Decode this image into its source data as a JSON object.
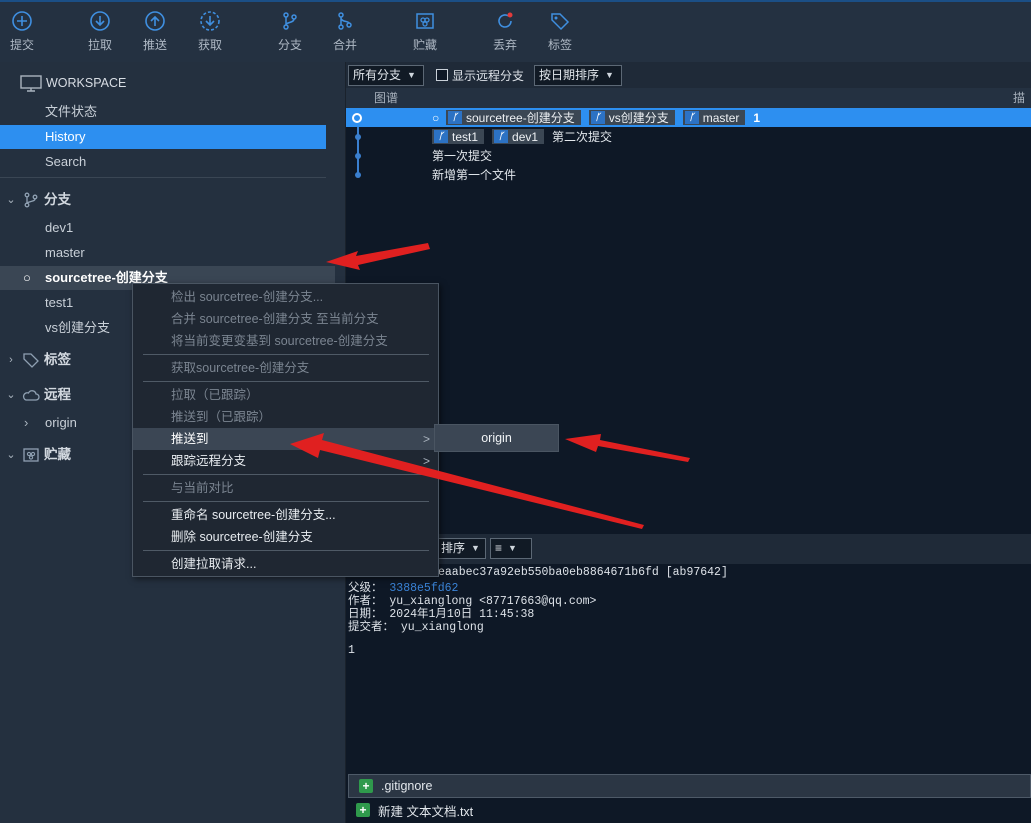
{
  "toolbar": {
    "commit": "提交",
    "pull": "拉取",
    "push": "推送",
    "fetch": "获取",
    "branch": "分支",
    "merge": "合并",
    "stash": "贮藏",
    "discard": "丢弃",
    "tag": "标签"
  },
  "sidebar": {
    "workspace": "WORKSPACE",
    "workspace_items": [
      "文件状态",
      "History",
      "Search"
    ],
    "branches_header": "分支",
    "branches": [
      "dev1",
      "master",
      "sourcetree-创建分支",
      "test1",
      "vs创建分支"
    ],
    "tags_header": "标签",
    "remotes_header": "远程",
    "remote_origin": "origin",
    "stash_header": "贮藏"
  },
  "filterbar": {
    "branch_select": "所有分支",
    "show_remote": "显示远程分支",
    "sort_select": "按日期排序"
  },
  "columns": {
    "graph": "图谱",
    "desc": "描"
  },
  "commits": [
    {
      "tags": [
        "sourcetree-创建分支",
        "vs创建分支",
        "master"
      ],
      "message": "1"
    },
    {
      "tags": [
        "test1",
        "dev1"
      ],
      "message": "第二次提交"
    },
    {
      "tags": [],
      "message": "第一次提交"
    },
    {
      "tags": [],
      "message": "新增第一个文件"
    }
  ],
  "lower_bar": {
    "sort_select": "排序",
    "view_select": "≡"
  },
  "details": {
    "commit_hash_tail": "eaabec37a92eb550ba0eb8864671b6fd [ab97642]",
    "parent_label": "父级：",
    "parent_hash": "3388e5fd62",
    "author_label": "作者：",
    "author": "yu_xianglong <87717663@qq.com>",
    "date_label": "日期：",
    "date": "2024年1月10日 11:45:38",
    "committer_label": "提交者：",
    "committer": "yu_xianglong",
    "message": "1"
  },
  "files": [
    ".gitignore",
    "新建 文本文档.txt"
  ],
  "context_menu": {
    "checkout": "检出 sourcetree-创建分支...",
    "merge_into": "合并 sourcetree-创建分支 至当前分支",
    "rebase": "将当前变更变基到 sourcetree-创建分支",
    "fetch": "获取sourcetree-创建分支",
    "pull_tracked": "拉取（已跟踪）",
    "push_tracked": "推送到（已跟踪）",
    "push_to": "推送到",
    "track_remote": "跟踪远程分支",
    "diff_current": "与当前对比",
    "rename": "重命名 sourcetree-创建分支...",
    "delete": "删除 sourcetree-创建分支",
    "create_pr": "创建拉取请求..."
  },
  "submenu": {
    "origin": "origin"
  },
  "colors": {
    "accent": "#2d8ff0",
    "arrow": "#e02020",
    "sidebar_bg": "#24303f",
    "graph_bg": "#0e1826"
  }
}
